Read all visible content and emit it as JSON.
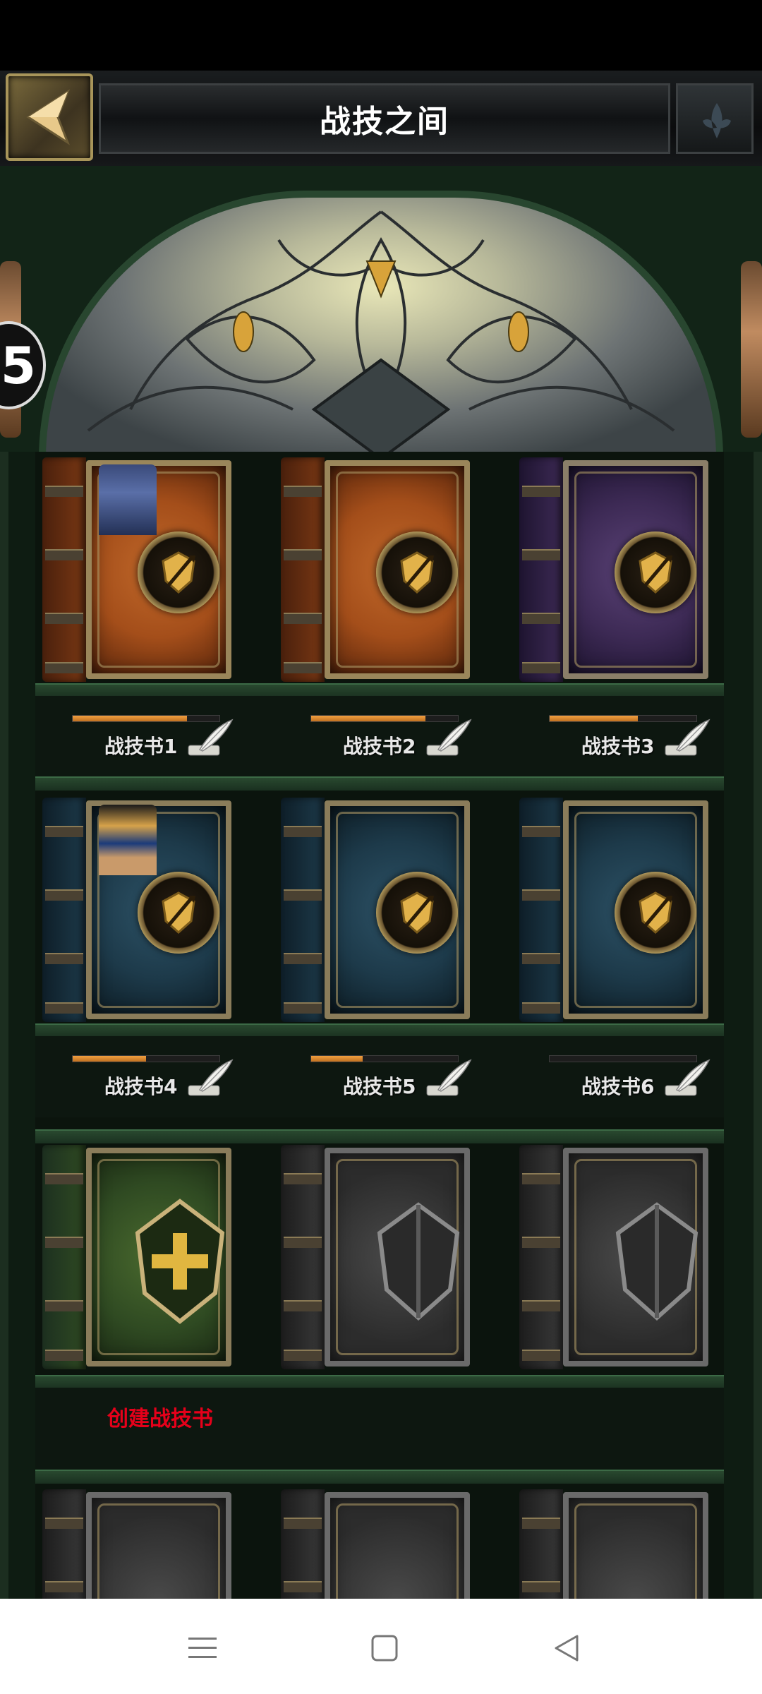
{
  "header": {
    "title": "战技之间"
  },
  "side_badge": {
    "text": "5"
  },
  "books": [
    {
      "label": "战技书1",
      "progress": 0.78,
      "color": "orange",
      "hero": "knight"
    },
    {
      "label": "战技书2",
      "progress": 0.78,
      "color": "orange",
      "hero": ""
    },
    {
      "label": "战技书3",
      "progress": 0.6,
      "color": "purple",
      "hero": ""
    },
    {
      "label": "战技书4",
      "progress": 0.5,
      "color": "blue",
      "hero": "pharaoh"
    },
    {
      "label": "战技书5",
      "progress": 0.35,
      "color": "blue",
      "hero": ""
    },
    {
      "label": "战技书6",
      "progress": 0.0,
      "color": "blue",
      "hero": ""
    }
  ],
  "create": {
    "label": "创建战技书"
  },
  "colors": {
    "orange_cover": "#a44e1a",
    "purple_cover": "#3d2a55",
    "blue_cover": "#1d3a4a",
    "green_cover": "#2f4a22",
    "grey_cover": "#3a3a3a",
    "create_text": "#e6001a"
  },
  "nav": {
    "menu_icon": "menu-icon",
    "home_icon": "home-icon",
    "back_icon": "back-triangle-icon"
  }
}
